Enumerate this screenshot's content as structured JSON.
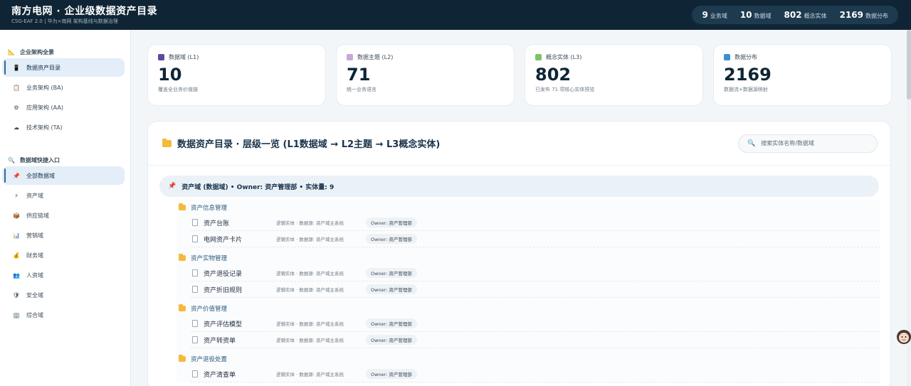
{
  "header": {
    "title": "南方电网 · 企业级数据资产目录",
    "subtitle": "CSG-EAF 2.0 | 华为×南网 架构基线与数据治理",
    "stats": [
      {
        "num": "9",
        "label": "业务域"
      },
      {
        "num": "10",
        "label": "数据域"
      },
      {
        "num": "802",
        "label": "概念实体"
      },
      {
        "num": "2169",
        "label": "数据分布"
      }
    ]
  },
  "sidebar": {
    "section1": "企业架构全景",
    "items1": [
      {
        "label": "数据资产目录",
        "icon": "phone-icon"
      },
      {
        "label": "业务架构 (BA)",
        "icon": "clipboard-icon"
      },
      {
        "label": "应用架构 (AA)",
        "icon": "gear-icon"
      },
      {
        "label": "技术架构 (TA)",
        "icon": "cloud-icon"
      }
    ],
    "section2": "数据域快捷入口",
    "items2": [
      {
        "label": "全部数据域",
        "icon": "pin-icon"
      },
      {
        "label": "资产域",
        "icon": "lightning-icon"
      },
      {
        "label": "供应链域",
        "icon": "box-icon"
      },
      {
        "label": "营销域",
        "icon": "bar-chart-icon"
      },
      {
        "label": "财务域",
        "icon": "money-bag-icon"
      },
      {
        "label": "人资域",
        "icon": "people-icon"
      },
      {
        "label": "安全域",
        "icon": "shield-icon"
      },
      {
        "label": "综合域",
        "icon": "building-icon"
      }
    ]
  },
  "cards": [
    {
      "label": "数据域 (L1)",
      "num": "10",
      "desc": "覆盖全业务价值链",
      "color": "#5b4a9e"
    },
    {
      "label": "数据主题 (L2)",
      "num": "71",
      "desc": "统一业务语言",
      "color": "#c9a7d9"
    },
    {
      "label": "概念实体 (L3)",
      "num": "802",
      "desc": "已发布 71 项核心实体预览",
      "color": "#7cc36a"
    },
    {
      "label": "数据分布",
      "num": "2169",
      "desc": "数据流+数据源映射",
      "color": "#3b8ed6"
    }
  ],
  "panel": {
    "title": "数据资产目录 · 层级一览 (L1数据域 → L2主题 → L3概念实体)",
    "search_placeholder": "搜索实体名称/数据域",
    "domain": "资产域 (数据域) • Owner: 资产管理部 • 实体量: 9",
    "subjects": [
      {
        "name": "资产信息管理",
        "entities": [
          {
            "name": "资产台账",
            "meta": "逻辑实体 · 数据源: 资产域主系统",
            "owner": "Owner: 资产管理部"
          },
          {
            "name": "电网资产卡片",
            "meta": "逻辑实体 · 数据源: 资产域主系统",
            "owner": "Owner: 资产管理部"
          }
        ]
      },
      {
        "name": "资产实物管理",
        "entities": [
          {
            "name": "资产退役记录",
            "meta": "逻辑实体 · 数据源: 资产域主系统",
            "owner": "Owner: 资产管理部"
          },
          {
            "name": "资产折旧规则",
            "meta": "逻辑实体 · 数据源: 资产域主系统",
            "owner": "Owner: 资产管理部"
          }
        ]
      },
      {
        "name": "资产价值管理",
        "entities": [
          {
            "name": "资产评估模型",
            "meta": "逻辑实体 · 数据源: 资产域主系统",
            "owner": "Owner: 资产管理部"
          },
          {
            "name": "资产转资单",
            "meta": "逻辑实体 · 数据源: 资产域主系统",
            "owner": "Owner: 资产管理部"
          }
        ]
      },
      {
        "name": "资产退役处置",
        "entities": [
          {
            "name": "资产清查单",
            "meta": "逻辑实体 · 数据源: 资产域主系统",
            "owner": "Owner: 资产管理部"
          }
        ]
      }
    ]
  }
}
